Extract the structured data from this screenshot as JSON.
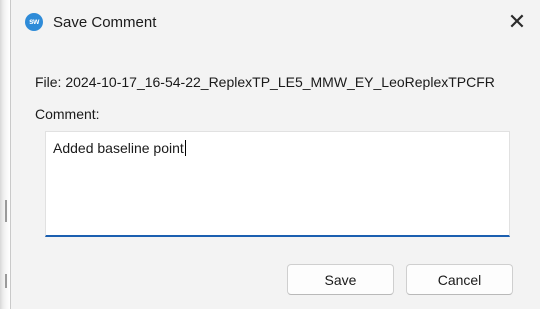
{
  "window": {
    "title": "Save Comment",
    "icon": "app-logo-icon",
    "icon_text": "sw",
    "close_glyph": "✕"
  },
  "file": {
    "label_and_name": "File: 2024-10-17_16-54-22_ReplexTP_LE5_MMW_EY_LeoReplexTPCFR"
  },
  "comment": {
    "label": "Comment:",
    "value": "Added baseline point"
  },
  "buttons": {
    "save_label": "Save",
    "cancel_label": "Cancel"
  },
  "colors": {
    "accent": "#1b5fb0",
    "dialog_bg": "#f3f3f3",
    "icon_bg": "#2e8bd8"
  }
}
